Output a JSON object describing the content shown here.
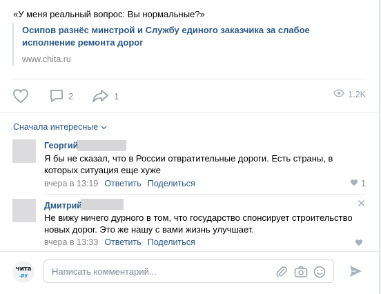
{
  "post": {
    "quote": "«У меня реальный вопрос: Вы нормальные?»",
    "link": {
      "title": "Осипов разнёс минстрой и Службу единого заказчика за слабое исполнение ремонта дорог",
      "source": "www.chita.ru"
    },
    "actions": {
      "like_icon": "heart-icon",
      "comment_icon": "comment-bubble-icon",
      "comments_count": "2",
      "share_icon": "share-arrow-icon",
      "shares_count": "1",
      "views_icon": "eye-icon",
      "views_count": "1.2K"
    }
  },
  "comments_section": {
    "sort_label": "Сначала интересные",
    "comments": [
      {
        "author": "Георгий",
        "text": "Я бы не сказал, что в России отвратительные дороги. Есть страны, в которых ситуация еще хуже",
        "time": "вчера в 13:19",
        "reply_label": "Ответить",
        "share_label": "Поделиться",
        "likes": "1"
      },
      {
        "author": "Дмитрий",
        "text": "Не вижу ничего дурного в том, что государство спонсирует строительство новых дорог. Это же нашу с вами жизнь улучшает.",
        "time": "вчера в 13:33",
        "reply_label": "Ответить",
        "share_label": "Поделиться",
        "likes": ""
      }
    ]
  },
  "composer": {
    "avatar_line1": "чита",
    "avatar_line2": ".ру",
    "placeholder": "Написать комментарий...",
    "icons": [
      "paperclip-icon",
      "camera-icon",
      "emoji-icon",
      "send-icon"
    ]
  },
  "colors": {
    "link": "#2a5885",
    "muted": "#828282",
    "icon": "#828a99",
    "border": "#dce1e6"
  }
}
